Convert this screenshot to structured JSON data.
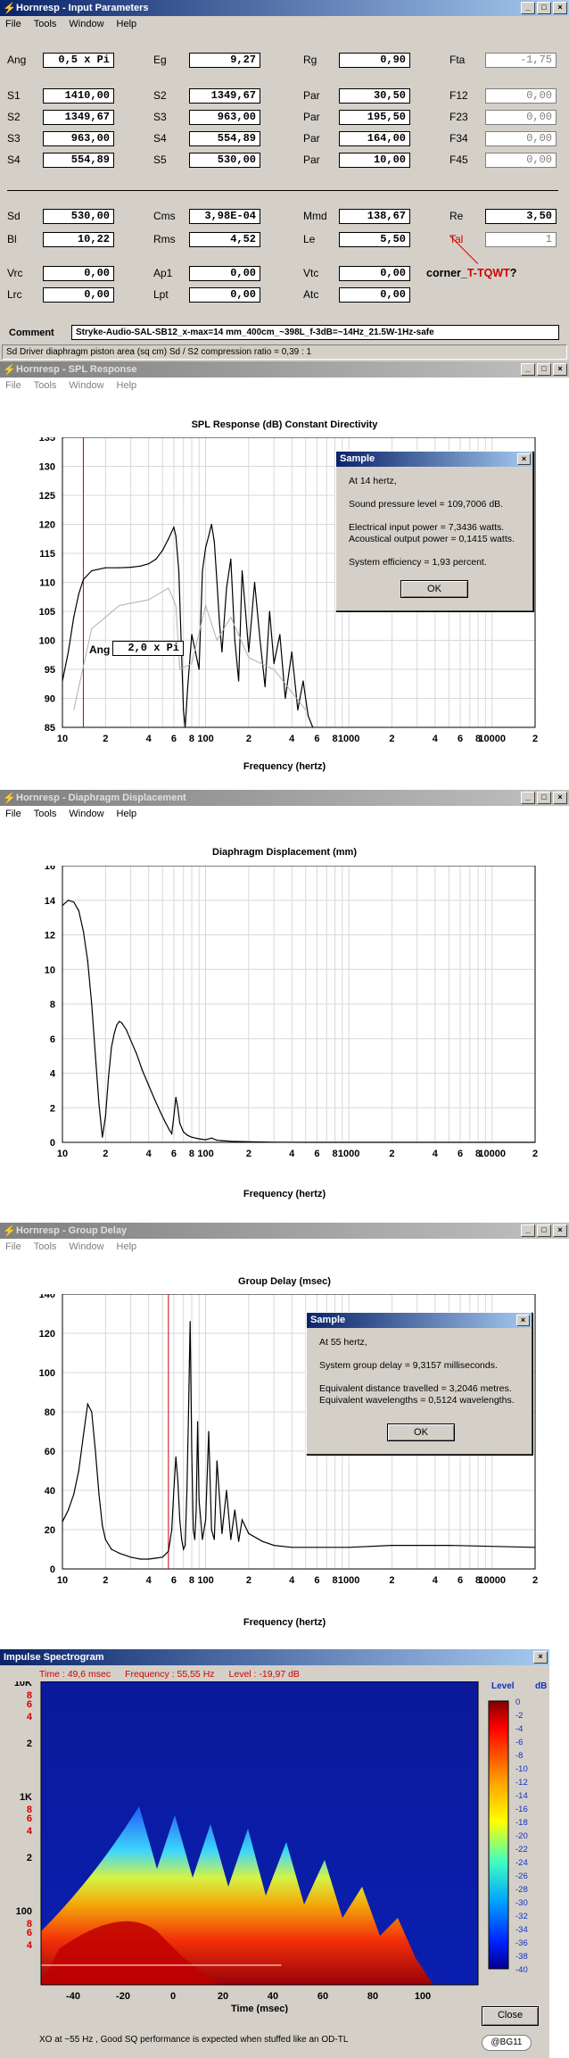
{
  "input_window": {
    "title": "Hornresp - Input Parameters",
    "menu": [
      "File",
      "Tools",
      "Window",
      "Help"
    ],
    "rows1": [
      [
        [
          "Ang",
          "0,5 x Pi"
        ],
        [
          "Eg",
          "9,27"
        ],
        [
          "Rg",
          "0,90"
        ],
        [
          "Fta",
          "-1,75"
        ]
      ],
      [
        [
          "S1",
          "1410,00"
        ],
        [
          "S2",
          "1349,67"
        ],
        [
          "Par",
          "30,50"
        ],
        [
          "F12",
          "0,00"
        ]
      ],
      [
        [
          "S2",
          "1349,67"
        ],
        [
          "S3",
          "963,00"
        ],
        [
          "Par",
          "195,50"
        ],
        [
          "F23",
          "0,00"
        ]
      ],
      [
        [
          "S3",
          "963,00"
        ],
        [
          "S4",
          "554,89"
        ],
        [
          "Par",
          "164,00"
        ],
        [
          "F34",
          "0,00"
        ]
      ],
      [
        [
          "S4",
          "554,89"
        ],
        [
          "S5",
          "530,00"
        ],
        [
          "Par",
          "10,00"
        ],
        [
          "F45",
          "0,00"
        ]
      ]
    ],
    "rows2": [
      [
        [
          "Sd",
          "530,00"
        ],
        [
          "Cms",
          "3,98E-04"
        ],
        [
          "Mmd",
          "138,67"
        ],
        [
          "Re",
          "3,50"
        ]
      ],
      [
        [
          "Bl",
          "10,22"
        ],
        [
          "Rms",
          "4,52"
        ],
        [
          "Le",
          "5,50"
        ],
        [
          "Tal",
          "1"
        ]
      ]
    ],
    "rows3": [
      [
        [
          "Vrc",
          "0,00"
        ],
        [
          "Ap1",
          "0,00"
        ],
        [
          "Vtc",
          "0,00"
        ]
      ],
      [
        [
          "Lrc",
          "0,00"
        ],
        [
          "Lpt",
          "0,00"
        ],
        [
          "Atc",
          "0,00"
        ]
      ]
    ],
    "corner_prefix": "corner_",
    "corner_red": "T-TQWT",
    "corner_suffix": "?",
    "comment_label": "Comment",
    "comment_value": "Stryke-Audio-SAL-SB12_x-max=14 mm_400cm_~398L_f-3dB=~14Hz_21.5W-1Hz-safe",
    "status": "Sd   Driver diaphragm piston area (sq cm)    Sd / S2 compression ratio = 0,39 : 1"
  },
  "spl_window": {
    "title": "Hornresp - SPL Response",
    "menu": [
      "File",
      "Tools",
      "Window",
      "Help"
    ],
    "plot_title": "SPL Response (dB)    Constant Directivity",
    "xlabel": "Frequency (hertz)",
    "ang_label": "Ang",
    "ang_value": "2,0 x Pi",
    "dialog": {
      "title": "Sample",
      "lines": [
        "At 14 hertz,",
        "",
        "Sound pressure level = 109,7006 dB.",
        "",
        "Electrical input power = 7,3436 watts.",
        "Acoustical output power = 0,1415 watts.",
        "",
        "System efficiency = 1,93 percent."
      ],
      "ok": "OK"
    }
  },
  "disp_window": {
    "title": "Hornresp - Diaphragm Displacement",
    "menu": [
      "File",
      "Tools",
      "Window",
      "Help"
    ],
    "plot_title": "Diaphragm Displacement (mm)",
    "xlabel": "Frequency (hertz)"
  },
  "gd_window": {
    "title": "Hornresp - Group Delay",
    "menu": [
      "File",
      "Tools",
      "Window",
      "Help"
    ],
    "plot_title": "Group Delay (msec)",
    "xlabel": "Frequency (hertz)",
    "dialog": {
      "title": "Sample",
      "lines": [
        "At 55 hertz,",
        "",
        "System group delay = 9,3157 milliseconds.",
        "",
        "Equivalent distance travelled = 3,2046 metres.",
        "Equivalent wavelengths = 0,5124 wavelengths."
      ],
      "ok": "OK"
    }
  },
  "spectro_window": {
    "title": "Impulse Spectrogram",
    "time_label": "Time : 49,6 msec",
    "freq_label": "Frequency : 55,55 Hz",
    "level_label": "Level : -19,97 dB",
    "legend_title": "Level",
    "legend_unit": "dB",
    "legend_ticks": [
      "0",
      "-2",
      "-4",
      "-6",
      "-8",
      "-10",
      "-12",
      "-14",
      "-16",
      "-18",
      "-20",
      "-22",
      "-24",
      "-26",
      "-28",
      "-30",
      "-32",
      "-34",
      "-36",
      "-38",
      "-40"
    ],
    "y_ticks": [
      "10K",
      "8",
      "6",
      "4",
      "2",
      "1K",
      "8",
      "6",
      "4",
      "2",
      "100",
      "8",
      "6",
      "4"
    ],
    "x_ticks": [
      "-40",
      "-20",
      "0",
      "20",
      "40",
      "60",
      "80",
      "100"
    ],
    "xlabel": "Time (msec)",
    "close": "Close",
    "footer": "XO at ~55 Hz , Good SQ performance is expected when stuffed like an OD-TL",
    "badge": "@BG11"
  },
  "chart_data": [
    {
      "type": "line",
      "title": "SPL Response (dB)    Constant Directivity",
      "xlabel": "Frequency (hertz)",
      "ylabel": "",
      "xscale": "log",
      "xlim": [
        10,
        20000
      ],
      "ylim": [
        85,
        135
      ],
      "yticks": [
        85,
        90,
        95,
        100,
        105,
        110,
        115,
        120,
        125,
        130,
        135
      ],
      "xtick_labels": [
        "10",
        "2",
        "4",
        "6",
        "8",
        "100",
        "2",
        "4",
        "6",
        "8",
        "1000",
        "2",
        "4",
        "6",
        "8",
        "10000",
        "2"
      ],
      "grid": true,
      "series": [
        {
          "values_x": [
            10,
            11,
            12,
            13,
            14,
            16,
            20,
            25,
            30,
            35,
            40,
            45,
            50,
            55,
            60,
            62,
            65,
            70,
            72,
            75,
            80,
            85,
            90,
            95,
            100,
            105,
            110,
            115,
            120,
            125,
            130,
            140,
            150,
            160,
            170,
            180,
            190,
            200,
            220,
            240,
            260,
            280,
            300,
            330,
            360,
            400,
            440,
            480,
            520,
            560
          ],
          "values_y": [
            93,
            98,
            104,
            108,
            110.5,
            112,
            112.5,
            112.5,
            112.6,
            112.8,
            113.2,
            114,
            115.5,
            117.5,
            119.5,
            118,
            112,
            88,
            85,
            92,
            101,
            98,
            95,
            112,
            116,
            118,
            120,
            117,
            110,
            103,
            98,
            109,
            114,
            100,
            93,
            112,
            105,
            98,
            110,
            100,
            92,
            105,
            96,
            101,
            90,
            98,
            88,
            93,
            87,
            85
          ]
        }
      ],
      "marker_x": 14
    },
    {
      "type": "line",
      "title": "Diaphragm Displacement (mm)",
      "xlabel": "Frequency (hertz)",
      "xscale": "log",
      "xlim": [
        10,
        20000
      ],
      "ylim": [
        0,
        16
      ],
      "yticks": [
        0,
        2,
        4,
        6,
        8,
        10,
        12,
        14,
        16
      ],
      "xtick_labels": [
        "10",
        "2",
        "4",
        "6",
        "8",
        "100",
        "2",
        "4",
        "6",
        "8",
        "1000",
        "2",
        "4",
        "6",
        "8",
        "10000",
        "2"
      ],
      "grid": true,
      "series": [
        {
          "values_x": [
            10,
            11,
            12,
            13,
            14,
            15,
            16,
            17,
            18,
            19,
            20,
            21,
            22,
            23,
            24,
            25,
            26,
            28,
            30,
            33,
            36,
            40,
            44,
            48,
            52,
            56,
            58,
            60,
            62,
            64,
            66,
            70,
            75,
            80,
            90,
            100,
            110,
            120,
            130,
            150,
            200,
            300,
            500,
            1000,
            20000
          ],
          "values_y": [
            13.7,
            14,
            13.9,
            13.4,
            12.2,
            10.5,
            8,
            5,
            2.2,
            0.3,
            1.5,
            3.8,
            5.5,
            6.3,
            6.8,
            7,
            6.9,
            6.5,
            5.9,
            5.1,
            4.2,
            3.3,
            2.5,
            1.8,
            1.2,
            0.7,
            0.5,
            1.5,
            2.6,
            2,
            1.1,
            0.6,
            0.4,
            0.3,
            0.2,
            0.15,
            0.25,
            0.12,
            0.1,
            0.06,
            0.03,
            0.01,
            0,
            0,
            0
          ]
        }
      ]
    },
    {
      "type": "line",
      "title": "Group Delay (msec)",
      "xlabel": "Frequency (hertz)",
      "xscale": "log",
      "xlim": [
        10,
        20000
      ],
      "ylim": [
        0,
        140
      ],
      "yticks": [
        0,
        20,
        40,
        60,
        80,
        100,
        120,
        140
      ],
      "xtick_labels": [
        "10",
        "2",
        "4",
        "6",
        "8",
        "100",
        "2",
        "4",
        "6",
        "8",
        "1000",
        "2",
        "4",
        "6",
        "8",
        "10000",
        "2"
      ],
      "grid": true,
      "series": [
        {
          "values_x": [
            10,
            11,
            12,
            13,
            14,
            15,
            16,
            17,
            18,
            19,
            20,
            22,
            25,
            30,
            35,
            40,
            45,
            50,
            55,
            58,
            60,
            62,
            64,
            66,
            68,
            70,
            72,
            74,
            76,
            78,
            80,
            82,
            84,
            86,
            88,
            90,
            95,
            100,
            105,
            110,
            115,
            120,
            130,
            140,
            150,
            160,
            170,
            180,
            200,
            250,
            300,
            400,
            600,
            1000,
            2000,
            5000,
            20000
          ],
          "values_y": [
            24,
            30,
            38,
            50,
            68,
            84,
            80,
            60,
            38,
            22,
            15,
            10,
            8,
            6,
            5,
            5,
            5.5,
            6,
            9,
            20,
            40,
            57,
            45,
            25,
            15,
            10,
            12,
            40,
            80,
            126,
            60,
            20,
            15,
            30,
            75,
            35,
            15,
            25,
            70,
            20,
            15,
            55,
            18,
            40,
            15,
            30,
            14,
            25,
            18,
            14,
            12,
            11,
            11,
            11,
            12,
            12,
            11
          ]
        }
      ],
      "marker_x": 55
    }
  ]
}
